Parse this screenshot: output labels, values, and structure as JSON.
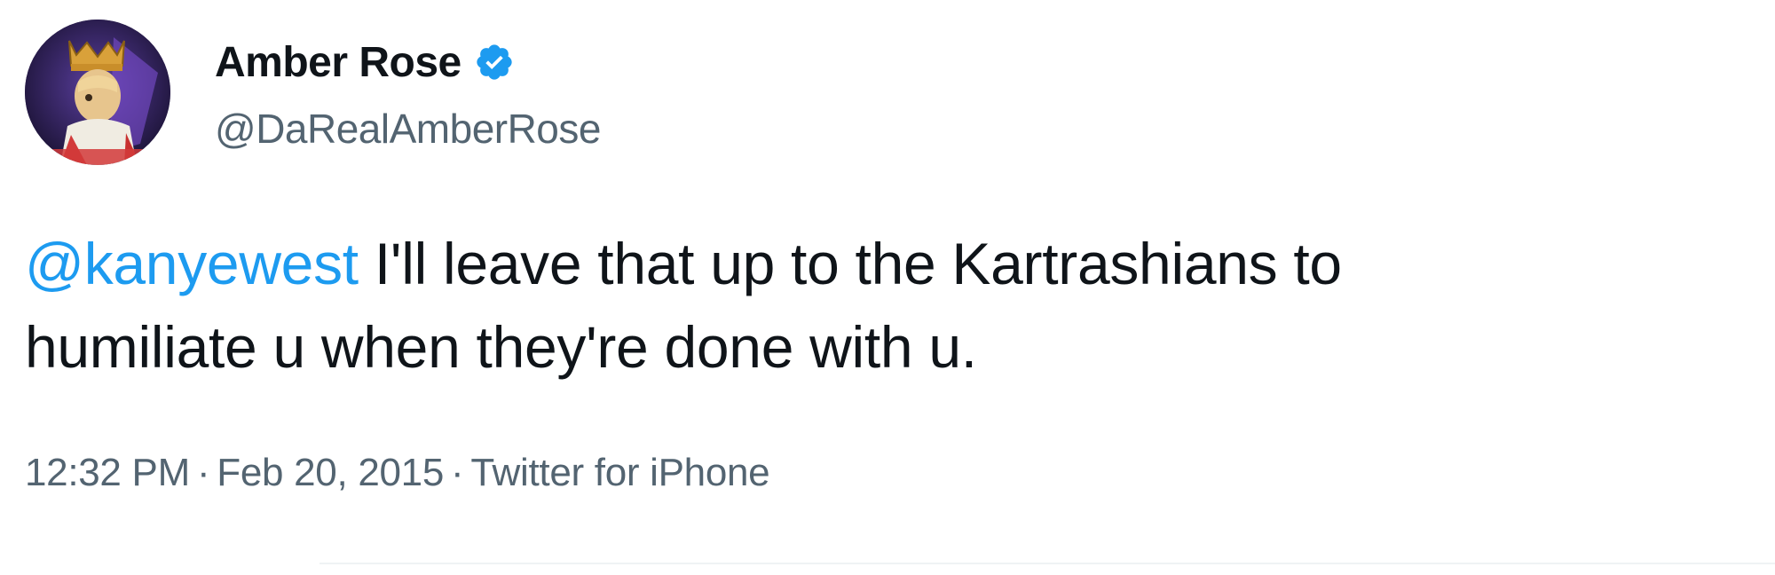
{
  "author": {
    "display_name": "Amber Rose",
    "handle": "@DaRealAmberRose",
    "verified": true,
    "avatar_icon": "crowned-figure-avatar",
    "verified_icon": "verified-badge-icon"
  },
  "tweet": {
    "mention": "@kanyewest",
    "text_line1": " I'll leave that up to the Kartrashians to",
    "text_line2": "humiliate u when they're done with u."
  },
  "meta": {
    "time": "12:32 PM",
    "separator": "·",
    "date": "Feb 20, 2015",
    "source": "Twitter for iPhone"
  },
  "colors": {
    "text": "#0f1419",
    "secondary": "#536471",
    "link": "#1d9bf0",
    "verified": "#1d9bf0"
  }
}
